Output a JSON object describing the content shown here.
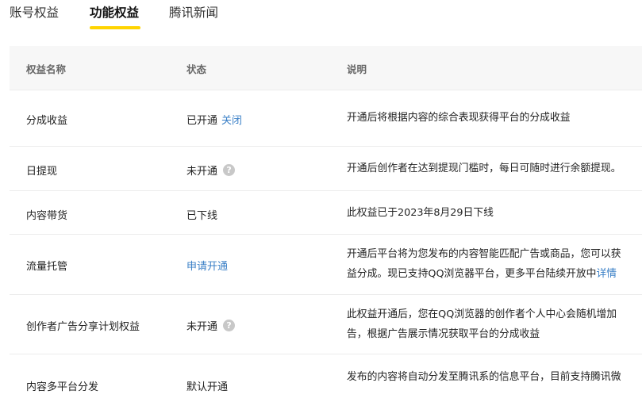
{
  "tabs": [
    {
      "label": "账号权益",
      "active": false
    },
    {
      "label": "功能权益",
      "active": true
    },
    {
      "label": "腾讯新闻",
      "active": false
    }
  ],
  "accent_color": "#ffd400",
  "link_color": "#3b80c7",
  "table": {
    "headers": [
      "权益名称",
      "状态",
      "说明"
    ],
    "rows": [
      {
        "name": "分成收益",
        "status": "已开通",
        "status_link": "关闭",
        "desc": [
          "开通后将根据内容的综合表现获得平台的分成收益"
        ]
      },
      {
        "name": "日提现",
        "status": "未开通",
        "help_icon": "question-circle-icon",
        "desc": [
          "开通后创作者在达到提现门槛时，每日可随时进行余额提现。"
        ]
      },
      {
        "name": "内容带货",
        "status": "已下线",
        "desc": [
          "此权益已于2023年8月29日下线"
        ]
      },
      {
        "name": "流量托管",
        "status_link": "申请开通",
        "desc": [
          "开通后平台将为您发布的内容智能匹配广告或商品，您可以获",
          "益分成。现已支持QQ浏览器平台，更多平台陆续开放中"
        ],
        "desc_link": "详情"
      },
      {
        "name": "创作者广告分享计划权益",
        "status": "未开通",
        "help_icon": "question-circle-icon",
        "desc": [
          "此权益开通后，您在QQ浏览器的创作者个人中心会随机增加",
          "告，根据广告展示情况获取平台的分成收益"
        ]
      },
      {
        "name": "内容多平台分发",
        "status": "默认开通",
        "desc": [
          "发布的内容将自动分发至腾讯系的信息平台，目前支持腾讯微"
        ]
      }
    ]
  }
}
